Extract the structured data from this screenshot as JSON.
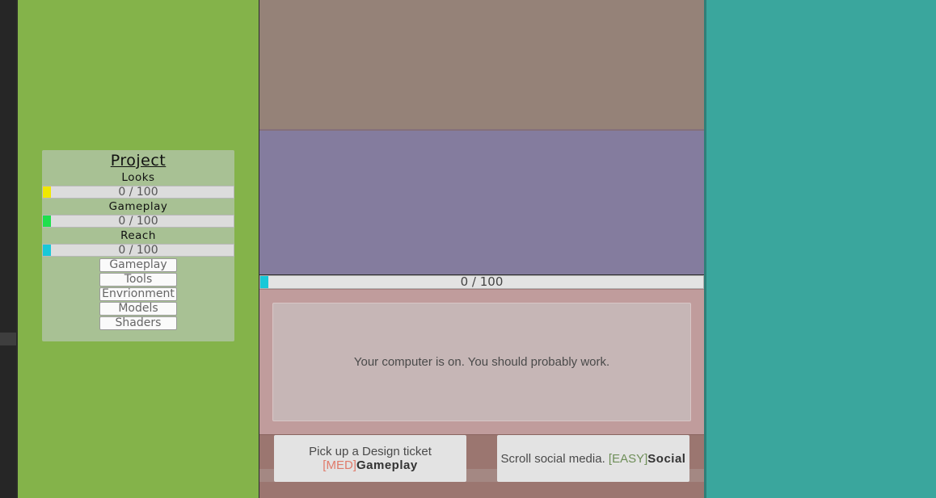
{
  "project": {
    "title": "Project",
    "stats": [
      {
        "label": "Looks",
        "value": 0,
        "max": 100,
        "text": "0 / 100",
        "color": "#f0e800"
      },
      {
        "label": "Gameplay",
        "value": 0,
        "max": 100,
        "text": "0 / 100",
        "color": "#1ee04c"
      },
      {
        "label": "Reach",
        "value": 0,
        "max": 100,
        "text": "0 / 100",
        "color": "#18c8d8"
      }
    ],
    "buttons": [
      "Gameplay",
      "Tools",
      "Envrionment",
      "Models",
      "Shaders"
    ]
  },
  "work_bar": {
    "value": 0,
    "max": 100,
    "text": "0 / 100",
    "color": "#18c8d8"
  },
  "message": "Your computer is on. You should probably work.",
  "tasks": {
    "design": {
      "text": "Pick up a Design ticket",
      "difficulty": "[MED]",
      "category": "Gameplay"
    },
    "social": {
      "text": "Scroll social media.",
      "difficulty": "[EASY]",
      "category": "Social"
    }
  }
}
